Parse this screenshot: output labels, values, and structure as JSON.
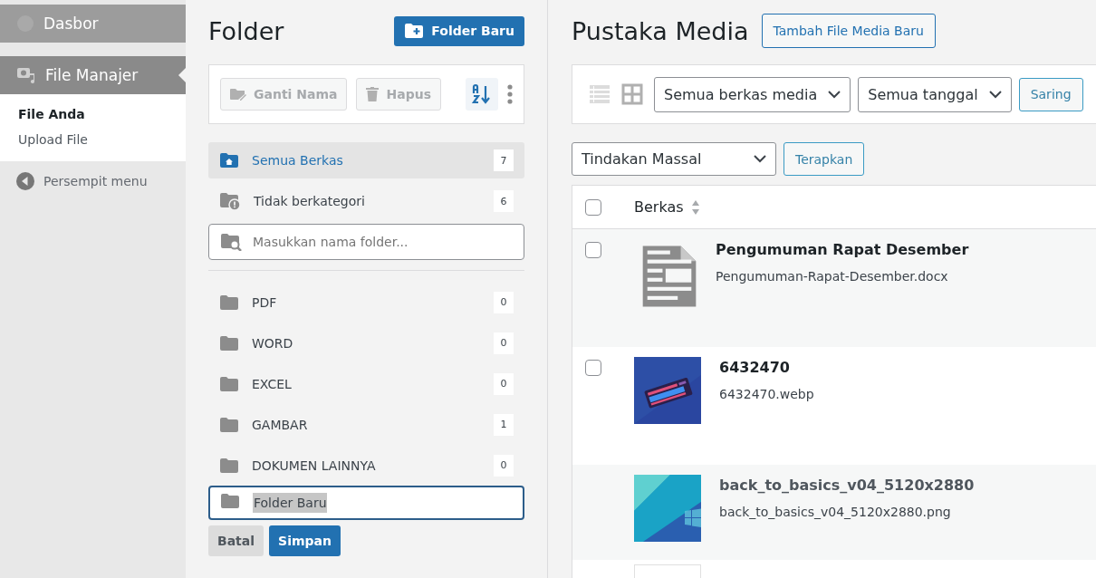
{
  "admin_menu": {
    "items": [
      {
        "label": "Dasbor",
        "selected": false
      },
      {
        "label": "File Manajer",
        "selected": true
      }
    ],
    "submenu": [
      {
        "label": "File Anda",
        "selected": true
      },
      {
        "label": "Upload File",
        "selected": false
      }
    ],
    "collapse": "Persempit menu"
  },
  "folder_panel": {
    "title": "Folder",
    "new_button": "Folder Baru",
    "toolbar": [
      {
        "label": "Ganti Nama",
        "disabled": true
      },
      {
        "label": "Hapus",
        "disabled": true
      }
    ],
    "special": [
      {
        "label": "Semua Berkas",
        "count": "7",
        "selected": true
      },
      {
        "label": "Tidak berkategori",
        "count": "6",
        "selected": false
      }
    ],
    "search": {
      "placeholder": "Masukkan nama folder..."
    },
    "folders": [
      {
        "name": "PDF",
        "count": "0"
      },
      {
        "name": "WORD",
        "count": "0"
      },
      {
        "name": "EXCEL",
        "count": "0"
      },
      {
        "name": "GAMBAR",
        "count": "1"
      },
      {
        "name": "DOKUMEN LAINNYA",
        "count": "0"
      }
    ],
    "new_folder": {
      "value": "Folder Baru",
      "cancel": "Batal",
      "save": "Simpan"
    }
  },
  "media": {
    "title": "Pustaka Media",
    "add_button": "Tambah File Media Baru",
    "filters": [
      {
        "value": "Semua berkas media"
      },
      {
        "value": "Semua tanggal"
      }
    ],
    "filter_button": "Saring",
    "view_modes": [
      {
        "selected": true
      },
      {
        "selected": false
      }
    ],
    "bulk": {
      "value": "Tindakan Massal",
      "button": "Terapkan"
    },
    "table": {
      "column": "Berkas",
      "select_all_checked": false,
      "rows": [
        {
          "title": "Pengumuman Rapat Desember",
          "file": "Pengumuman-Rapat-Desember.docx",
          "kind": "document",
          "checked": false
        },
        {
          "title": "6432470",
          "file": "6432470.webp",
          "kind": "keyboard",
          "checked": false
        },
        {
          "title": "back_to_basics_v04_5120x2880",
          "file": "back_to_basics_v04_5120x2880.png",
          "kind": "wallpaper"
        },
        {
          "kind": "blank"
        }
      ]
    }
  }
}
